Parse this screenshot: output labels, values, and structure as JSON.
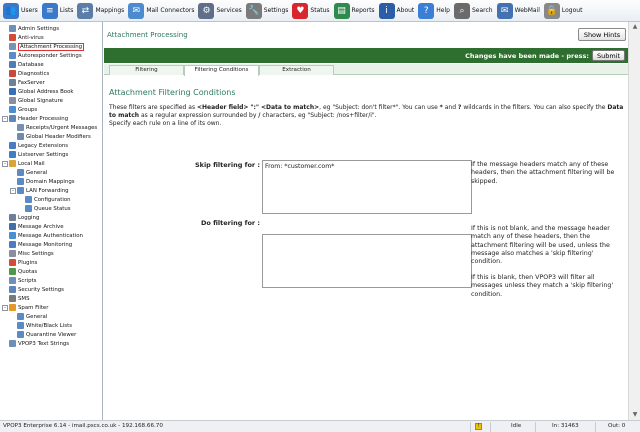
{
  "toolbar": {
    "items": [
      {
        "label": "Users",
        "icon": "users-icon",
        "color": "#3a78c9"
      },
      {
        "label": "Lists",
        "icon": "lists-icon",
        "color": "#3a78c9"
      },
      {
        "label": "Mappings",
        "icon": "mappings-icon",
        "color": "#5a7ea8"
      },
      {
        "label": "Mail Connectors",
        "icon": "mail-connectors-icon",
        "color": "#4d8bd0"
      },
      {
        "label": "Services",
        "icon": "services-icon",
        "color": "#5f6f8a"
      },
      {
        "label": "Settings",
        "icon": "settings-icon",
        "color": "#7a7a7a"
      },
      {
        "label": "Status",
        "icon": "status-heart-icon",
        "color": "#d8262e"
      },
      {
        "label": "Reports",
        "icon": "reports-icon",
        "color": "#2f8a4b"
      },
      {
        "label": "About",
        "icon": "about-icon",
        "color": "#2b5ea7"
      },
      {
        "label": "Help",
        "icon": "help-icon",
        "color": "#3a7fd5"
      },
      {
        "label": "Search",
        "icon": "search-icon",
        "color": "#6a6a6a"
      },
      {
        "label": "WebMail",
        "icon": "webmail-icon",
        "color": "#4472b0"
      },
      {
        "label": "Logout",
        "icon": "logout-lock-icon",
        "color": "#888888"
      }
    ]
  },
  "sidebar": {
    "items": [
      {
        "label": "Admin Settings",
        "indent": 0,
        "color": "#6d8fb8"
      },
      {
        "label": "Anti-virus",
        "indent": 0,
        "color": "#d24c3a"
      },
      {
        "label": "Attachment Processing",
        "indent": 0,
        "color": "#7b93b3",
        "selected": true
      },
      {
        "label": "Autoresponder Settings",
        "indent": 0,
        "color": "#5a8bc6"
      },
      {
        "label": "Database",
        "indent": 0,
        "color": "#4d7fb6"
      },
      {
        "label": "Diagnostics",
        "indent": 0,
        "color": "#c94a3a"
      },
      {
        "label": "FaxServer",
        "indent": 0,
        "color": "#6f7f96"
      },
      {
        "label": "Global Address Book",
        "indent": 0,
        "color": "#3a6fb6"
      },
      {
        "label": "Global Signature",
        "indent": 0,
        "color": "#8a8fa0"
      },
      {
        "label": "Groups",
        "indent": 0,
        "color": "#4a8fd0"
      },
      {
        "label": "Header Processing",
        "indent": 0,
        "color": "#5f86b8",
        "toggle": "-"
      },
      {
        "label": "Receipts/Urgent Messages",
        "indent": 1,
        "color": "#7790b0"
      },
      {
        "label": "Global Header Modifiers",
        "indent": 1,
        "color": "#6f8cae"
      },
      {
        "label": "Legacy Extensions",
        "indent": 0,
        "color": "#4c7bc4"
      },
      {
        "label": "Listserver Settings",
        "indent": 0,
        "color": "#3d7ec6"
      },
      {
        "label": "Local Mail",
        "indent": 0,
        "color": "#d9a43a",
        "toggle": "-"
      },
      {
        "label": "General",
        "indent": 1,
        "color": "#5a8bc6"
      },
      {
        "label": "Domain Mappings",
        "indent": 1,
        "color": "#5a8bc6"
      },
      {
        "label": "LAN Forwarding",
        "indent": 1,
        "color": "#5a8bc6",
        "toggle": "-"
      },
      {
        "label": "Configuration",
        "indent": 2,
        "color": "#5a8bc6"
      },
      {
        "label": "Queue Status",
        "indent": 2,
        "color": "#5a8bc6"
      },
      {
        "label": "Logging",
        "indent": 0,
        "color": "#6f7f96"
      },
      {
        "label": "Message Archive",
        "indent": 0,
        "color": "#3e6fa8"
      },
      {
        "label": "Message Authentication",
        "indent": 0,
        "color": "#4a8fd0"
      },
      {
        "label": "Message Monitoring",
        "indent": 0,
        "color": "#4c7bc4"
      },
      {
        "label": "Misc Settings",
        "indent": 0,
        "color": "#8a8fa0"
      },
      {
        "label": "Plugins",
        "indent": 0,
        "color": "#d24c3a"
      },
      {
        "label": "Quotas",
        "indent": 0,
        "color": "#4f9a4a"
      },
      {
        "label": "Scripts",
        "indent": 0,
        "color": "#6d8fb8"
      },
      {
        "label": "Security Settings",
        "indent": 0,
        "color": "#5f86b8"
      },
      {
        "label": "SMS",
        "indent": 0,
        "color": "#7a7a7a"
      },
      {
        "label": "Spam Filter",
        "indent": 0,
        "color": "#e29b2a",
        "toggle": "-"
      },
      {
        "label": "General",
        "indent": 1,
        "color": "#5a8bc6"
      },
      {
        "label": "White/Black Lists",
        "indent": 1,
        "color": "#5a8bc6"
      },
      {
        "label": "Quarantine Viewer",
        "indent": 1,
        "color": "#5a8bc6"
      },
      {
        "label": "VPOP3 Text Strings",
        "indent": 0,
        "color": "#6d8fb8"
      }
    ]
  },
  "main": {
    "page_title": "Attachment Processing",
    "show_hints_label": "Show Hints",
    "changes_text": "Changes have been made - press:",
    "submit_label": "Submit",
    "tabs": [
      {
        "label": "Filtering"
      },
      {
        "label": "Filtering Conditions",
        "active": true
      },
      {
        "label": "Extraction"
      }
    ],
    "section_title": "Attachment Filtering Conditions",
    "intro": {
      "p1": "These filters are specified as ",
      "b1": "<Header field>",
      "p2": " ",
      "b2": "\":\"",
      "p3": " ",
      "b3": "<Data to match>",
      "p4": ", eg \"Subject: don't filter*\". You can use ",
      "b4": "*",
      "p5": " and ",
      "b5": "?",
      "p6": " wildcards in the filters. You can also specify the ",
      "b6": "Data to match",
      "p7": " as a regular expression surrounded by ",
      "b7": "/",
      "p8": " characters, eg \"Subject: /nos+filter/i\".",
      "line3": "Specify each rule on a line of its own."
    },
    "skip_label": "Skip filtering for :",
    "skip_value": "From: *customer.com*",
    "skip_help": "If the message headers match any of these headers, then the attachment filtering will be skipped.",
    "do_label": "Do filtering for :",
    "do_value": "",
    "do_help_1": "If this is not blank, and the message header match any of these headers, then the attachment filtering will be used, unless the message also matches a 'skip filtering' condition.",
    "do_help_2": "If this is blank, then VPOP3 will filter all messages unless they match a 'skip filtering' condition."
  },
  "status": {
    "left": "VPOP3 Enterprise 6.14 - imail.pscs.co.uk - 192.168.66.70",
    "state": "Idle",
    "in": "In: 31463",
    "out": "Out: 0"
  }
}
